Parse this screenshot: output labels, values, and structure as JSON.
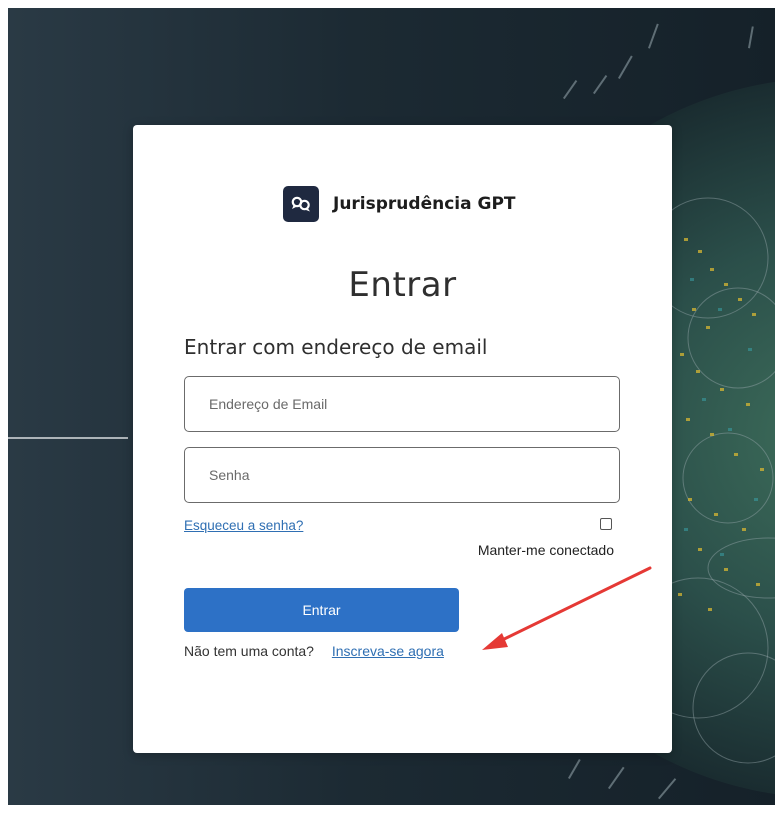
{
  "brand": {
    "name": "Jurisprudência GPT",
    "logo_icon": "chat-bubbles-icon",
    "logo_color": "#1f2940"
  },
  "login": {
    "title": "Entrar",
    "subtitle": "Entrar com endereço de email",
    "email_placeholder": "Endereço de Email",
    "email_value": "",
    "password_placeholder": "Senha",
    "password_value": "",
    "forgot_password": "Esqueceu a senha?",
    "remember_me": "Manter-me conectado",
    "remember_checked": false,
    "submit_label": "Entrar",
    "no_account_text": "Não tem uma conta?",
    "signup_link": "Inscreva-se agora"
  },
  "annotation": {
    "arrow_icon": "red-arrow-icon",
    "arrow_color": "#e53935"
  },
  "colors": {
    "primary_button": "#2d71c6",
    "link": "#2f6fb3",
    "background_dark": "#1c2a33"
  }
}
